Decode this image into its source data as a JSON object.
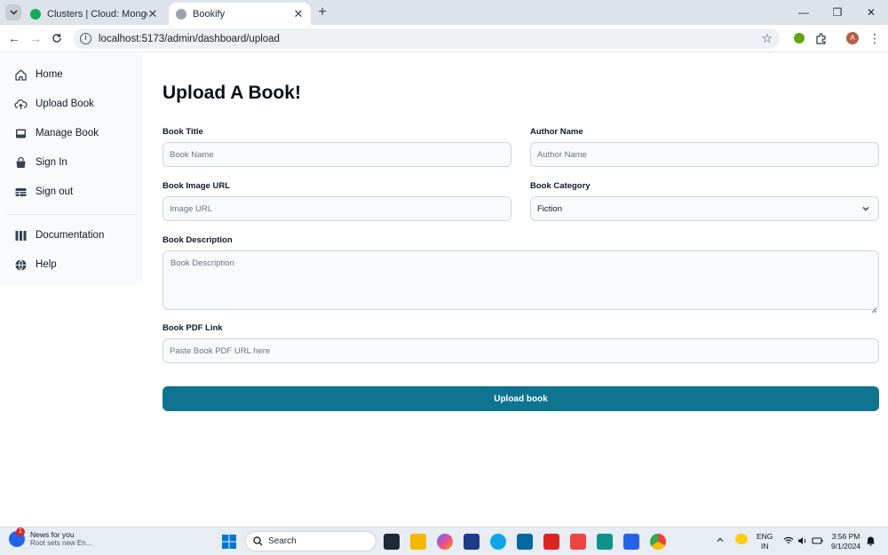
{
  "browser": {
    "tabs": [
      {
        "title": "Clusters | Cloud: MongoDB Clo",
        "active": false
      },
      {
        "title": "Bookify",
        "active": true
      }
    ],
    "new_tab": "+",
    "url": "localhost:5173/admin/dashboard/upload",
    "profile_initial": "A"
  },
  "sidebar": {
    "items": [
      {
        "label": "Home",
        "icon": "home-icon"
      },
      {
        "label": "Upload Book",
        "icon": "cloud-upload-icon"
      },
      {
        "label": "Manage Book",
        "icon": "inbox-icon"
      },
      {
        "label": "Sign In",
        "icon": "shopping-bag-icon"
      },
      {
        "label": "Sign out",
        "icon": "table-icon"
      },
      {
        "label": "Documentation",
        "icon": "columns-icon"
      },
      {
        "label": "Help",
        "icon": "globe-icon"
      }
    ]
  },
  "main": {
    "title": "Upload A Book!",
    "fields": {
      "book_title": {
        "label": "Book Title",
        "placeholder": "Book Name"
      },
      "author_name": {
        "label": "Author Name",
        "placeholder": "Author Name"
      },
      "image_url": {
        "label": "Book Image URL",
        "placeholder": "Image URL"
      },
      "category": {
        "label": "Book Category",
        "value": "Fiction"
      },
      "description": {
        "label": "Book Description",
        "placeholder": "Book Description"
      },
      "pdf_link": {
        "label": "Book PDF Link",
        "placeholder": "Paste Book PDF URL here"
      }
    },
    "submit_label": "Upload book"
  },
  "taskbar": {
    "news_title": "News for you",
    "news_subtitle": "Root sets new En...",
    "news_badge": "1",
    "search_label": "Search",
    "lang_line1": "ENG",
    "lang_line2": "IN",
    "time": "3:56 PM",
    "date": "9/1/2024"
  },
  "colors": {
    "accent": "#0e7490",
    "sidebar_bg": "#f9fafb",
    "input_bg": "#f9fafb"
  }
}
